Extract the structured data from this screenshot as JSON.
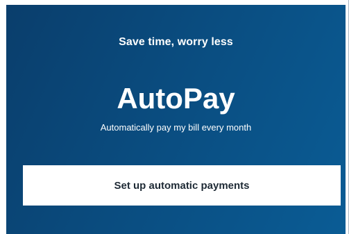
{
  "promo": {
    "kicker": "Save time, worry less",
    "title": "AutoPay",
    "subtitle": "Automatically pay my bill every month",
    "cta_label": "Set up automatic payments"
  },
  "colors": {
    "background_start": "#0a3e6c",
    "background_end": "#0a5c95",
    "button_bg": "#ffffff",
    "button_text": "#1e2a35",
    "text": "#ffffff"
  }
}
